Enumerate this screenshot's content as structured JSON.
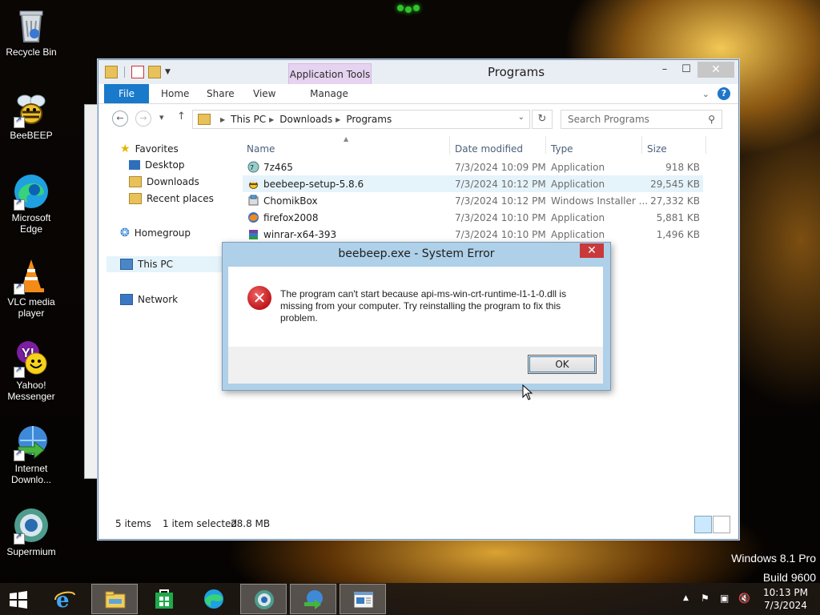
{
  "desktop": {
    "icons": [
      {
        "label": "Recycle Bin"
      },
      {
        "label": "BeeBEEP"
      },
      {
        "label": "Microsoft Edge"
      },
      {
        "label": "VLC media player"
      },
      {
        "label": "Yahoo! Messenger"
      },
      {
        "label": "Internet Downlo..."
      },
      {
        "label": "Supermium"
      }
    ],
    "watermark": {
      "line1": "Windows 8.1 Pro",
      "line2": "Build 9600"
    }
  },
  "explorer": {
    "title": "Programs",
    "contextual_tab": "Application Tools",
    "ribbon_tabs": {
      "file": "File",
      "home": "Home",
      "share": "Share",
      "view": "View",
      "manage": "Manage"
    },
    "breadcrumb": [
      "This PC",
      "Downloads",
      "Programs"
    ],
    "search_placeholder": "Search Programs",
    "nav": {
      "favorites": "Favorites",
      "desktop": "Desktop",
      "downloads": "Downloads",
      "recent": "Recent places",
      "homegroup": "Homegroup",
      "thispc": "This PC",
      "network": "Network"
    },
    "columns": {
      "name": "Name",
      "date": "Date modified",
      "type": "Type",
      "size": "Size"
    },
    "files": [
      {
        "name": "7z465",
        "date": "7/3/2024 10:09 PM",
        "type": "Application",
        "size": "918 KB"
      },
      {
        "name": "beebeep-setup-5.8.6",
        "date": "7/3/2024 10:12 PM",
        "type": "Application",
        "size": "29,545 KB",
        "selected": true
      },
      {
        "name": "ChomikBox",
        "date": "7/3/2024 10:12 PM",
        "type": "Windows Installer ...",
        "size": "27,332 KB"
      },
      {
        "name": "firefox2008",
        "date": "7/3/2024 10:10 PM",
        "type": "Application",
        "size": "5,881 KB"
      },
      {
        "name": "winrar-x64-393",
        "date": "7/3/2024 10:10 PM",
        "type": "Application",
        "size": "1,496 KB"
      }
    ],
    "status": {
      "items": "5 items",
      "selected": "1 item selected",
      "size": "28.8 MB"
    }
  },
  "dialog": {
    "title": "beebeep.exe - System Error",
    "message": "The program can't start because api-ms-win-crt-runtime-l1-1-0.dll is missing from your computer. Try reinstalling the program to fix this problem.",
    "ok_label": "OK"
  },
  "taskbar": {
    "time": "10:13 PM",
    "date": "7/3/2024"
  }
}
